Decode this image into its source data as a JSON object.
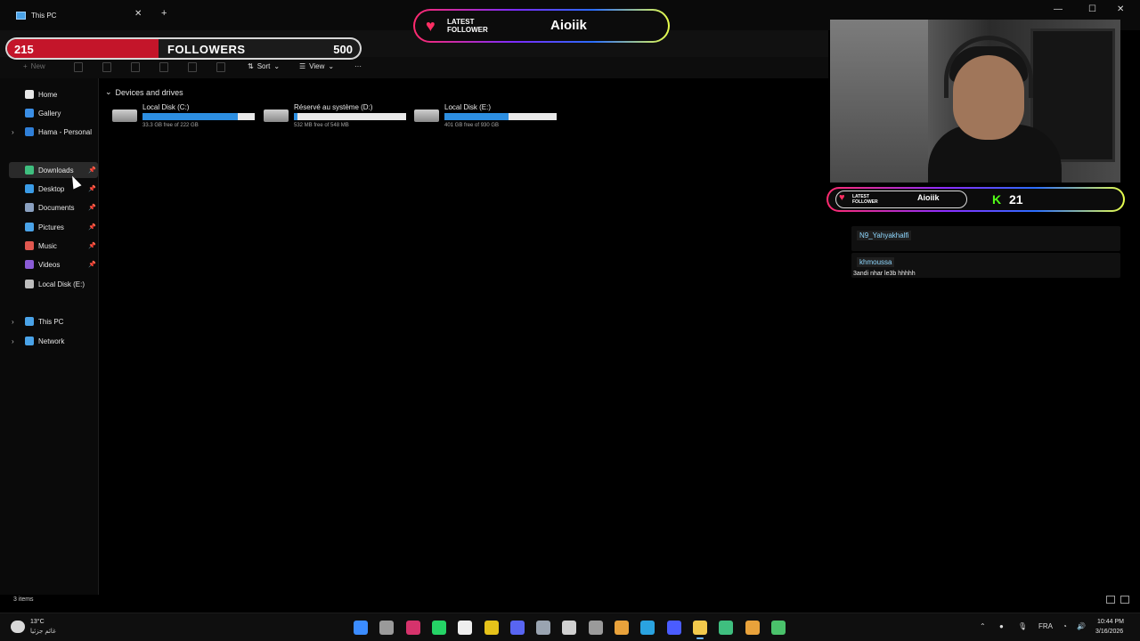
{
  "window": {
    "tab_title": "This PC",
    "tab_close": "✕",
    "tab_add": "+",
    "controls": {
      "minimize": "—",
      "maximize": "☐",
      "close": "✕"
    }
  },
  "toolbar": {
    "new_label": "New",
    "sort_label": "Sort",
    "view_label": "View",
    "more_label": "···"
  },
  "followers_goal": {
    "current": "215",
    "label": "FOLLOWERS",
    "goal": "500",
    "progress_fraction": 0.43,
    "color": "#c4152a"
  },
  "latest_follower_top": {
    "label": "LATEST FOLLOWER",
    "name": "Aioiik"
  },
  "sidebar": {
    "items": [
      {
        "label": "Home",
        "icon": "home-icon",
        "color": "#e8e8e8"
      },
      {
        "label": "Gallery",
        "icon": "gallery-icon",
        "color": "#3a8ee6"
      },
      {
        "label": "Hama - Personal",
        "icon": "onedrive-icon",
        "color": "#2f7fd8"
      },
      {
        "label": "Downloads",
        "icon": "download-icon",
        "color": "#3fbf7f"
      },
      {
        "label": "Desktop",
        "icon": "desktop-icon",
        "color": "#3a9be6"
      },
      {
        "label": "Documents",
        "icon": "documents-icon",
        "color": "#8aa0c0"
      },
      {
        "label": "Pictures",
        "icon": "pictures-icon",
        "color": "#4aa3e8"
      },
      {
        "label": "Music",
        "icon": "music-icon",
        "color": "#e0574f"
      },
      {
        "label": "Videos",
        "icon": "videos-icon",
        "color": "#8a5bd6"
      },
      {
        "label": "Local Disk (E:)",
        "icon": "drive-icon",
        "color": "#bdbdbd"
      },
      {
        "label": "This PC",
        "icon": "this-pc-icon",
        "color": "#4aa3e8"
      },
      {
        "label": "Network",
        "icon": "network-icon",
        "color": "#4aa3e8"
      }
    ]
  },
  "content": {
    "section_title": "Devices and drives",
    "drives": [
      {
        "name": "Local Disk (C:)",
        "free_text": "33.3 GB free of 222 GB",
        "used_fraction": 0.85
      },
      {
        "name": "Réservé au système (D:)",
        "free_text": "532 MB free of 548 MB",
        "used_fraction": 0.03
      },
      {
        "name": "Local Disk (E:)",
        "free_text": "401 GB free of 930 GB",
        "used_fraction": 0.57
      }
    ]
  },
  "status_bar": {
    "items_text": "3 items"
  },
  "stream_overlay": {
    "latest_follower_label": "LATEST FOLLOWER",
    "latest_follower_name": "Aioiik",
    "kick_icon": "K",
    "kick_count": "21",
    "chat": [
      {
        "user": "N9_Yahyakhalfi",
        "message": ""
      },
      {
        "user": "khmoussa",
        "message": "3andi nhar le3b hhhhh"
      }
    ]
  },
  "taskbar": {
    "weather_temp": "13°C",
    "weather_desc": "غائم جزئيا",
    "language": "FRA",
    "time": "10:44 PM",
    "date": "3/16/2026",
    "apps": [
      {
        "name": "start-icon",
        "color": "#3b8cff"
      },
      {
        "name": "task-view-icon",
        "color": "#9a9a9a"
      },
      {
        "name": "instagram-icon",
        "color": "#d6336c"
      },
      {
        "name": "whatsapp-icon",
        "color": "#25d366"
      },
      {
        "name": "tiktok-icon",
        "color": "#eeeeee"
      },
      {
        "name": "app-yellow-icon",
        "color": "#e6c21a"
      },
      {
        "name": "discord-icon",
        "color": "#5865f2"
      },
      {
        "name": "steam-icon",
        "color": "#9aa4b1"
      },
      {
        "name": "openai-icon",
        "color": "#d0d0d0"
      },
      {
        "name": "speed-icon",
        "color": "#9a9a9a"
      },
      {
        "name": "chrome-icon",
        "color": "#e9a23b"
      },
      {
        "name": "telegram-icon",
        "color": "#2aa3e0"
      },
      {
        "name": "circle-app-icon",
        "color": "#4a5cff"
      },
      {
        "name": "file-explorer-icon",
        "color": "#f2c94c"
      },
      {
        "name": "obs-icon",
        "color": "#3fbf7f"
      },
      {
        "name": "chrome-icon",
        "color": "#e9a23b"
      },
      {
        "name": "terminal-icon",
        "color": "#4ac26b"
      }
    ]
  }
}
